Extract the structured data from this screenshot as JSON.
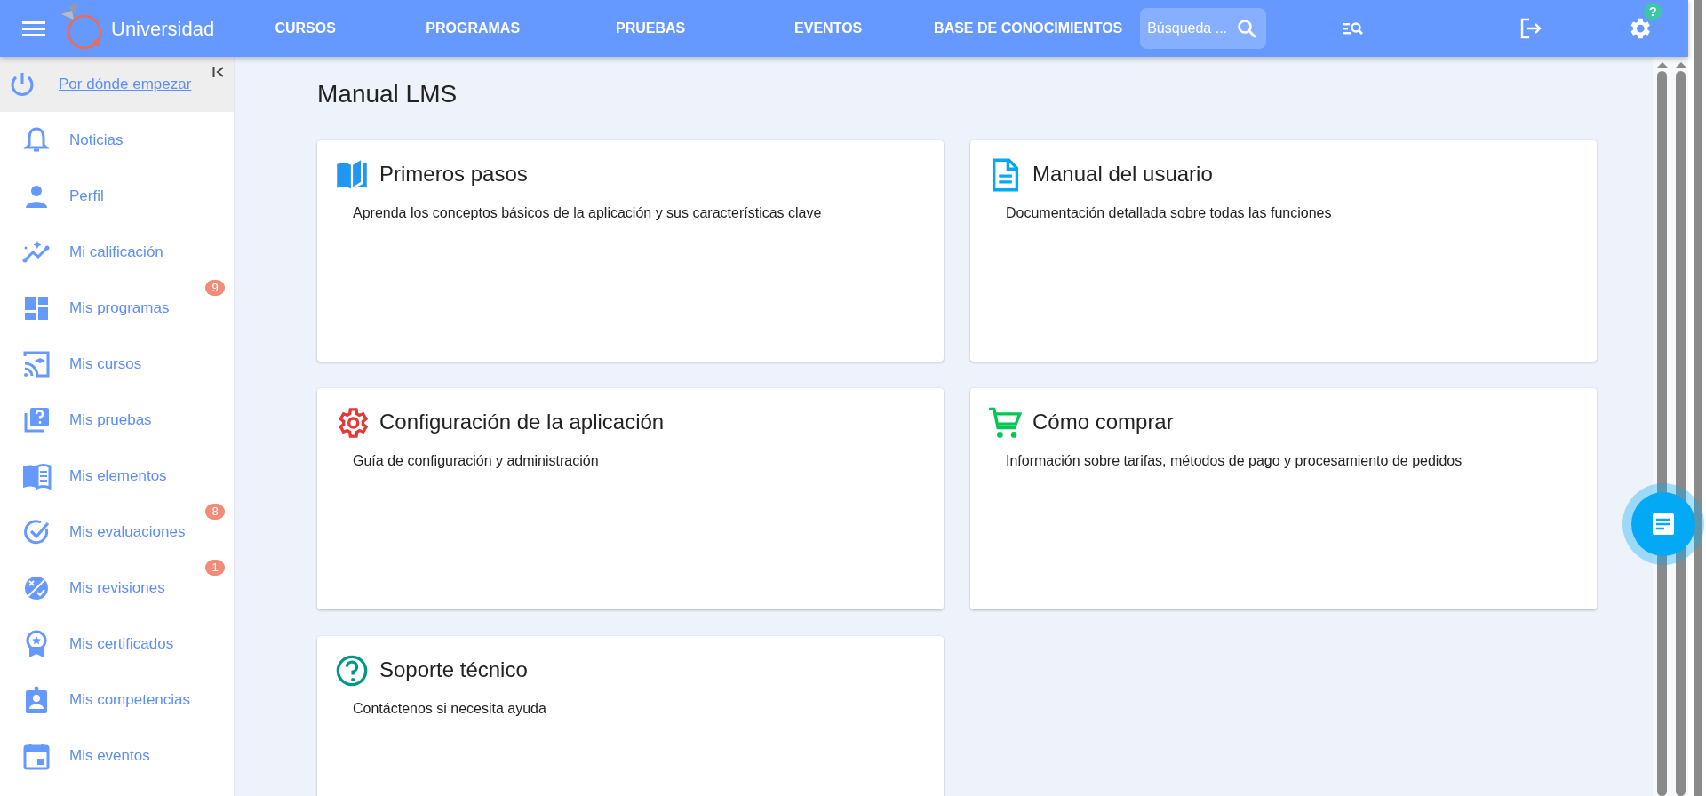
{
  "header": {
    "brand": "Universidad",
    "nav": [
      {
        "label": "CURSOS"
      },
      {
        "label": "PROGRAMAS"
      },
      {
        "label": "PRUEBAS"
      },
      {
        "label": "EVENTOS"
      },
      {
        "label": "BASE DE CONOCIMIENTOS"
      }
    ],
    "search": {
      "placeholder": "Búsqueda ..."
    },
    "help_badge": "?"
  },
  "sidebar": {
    "start_link": "Por dónde empezar",
    "items": [
      {
        "label": "Noticias"
      },
      {
        "label": "Perfil"
      },
      {
        "label": "Mi calificación"
      },
      {
        "label": "Mis programas",
        "badge": "9"
      },
      {
        "label": "Mis cursos"
      },
      {
        "label": "Mis pruebas"
      },
      {
        "label": "Mis elementos"
      },
      {
        "label": "Mis evaluaciones",
        "badge": "8"
      },
      {
        "label": "Mis revisiones",
        "badge": "1"
      },
      {
        "label": "Mis certificados"
      },
      {
        "label": "Mis competencias"
      },
      {
        "label": "Mis eventos"
      }
    ]
  },
  "main": {
    "title": "Manual LMS",
    "cards": [
      {
        "title": "Primeros pasos",
        "description": "Aprenda los conceptos básicos de la aplicación y sus características clave",
        "color": "#2196f3"
      },
      {
        "title": "Manual del usuario",
        "description": "Documentación detallada sobre todas las funciones",
        "color": "#03a9f4"
      },
      {
        "title": "Configuración de la aplicación",
        "description": "Guía de configuración y administración",
        "color": "#e53935"
      },
      {
        "title": "Cómo comprar",
        "description": "Información sobre tarifas, métodos de pago y procesamiento de pedidos",
        "color": "#00c853"
      },
      {
        "title": "Soporte técnico",
        "description": "Contáctenos si necesita ayuda",
        "color": "#009688"
      }
    ]
  }
}
